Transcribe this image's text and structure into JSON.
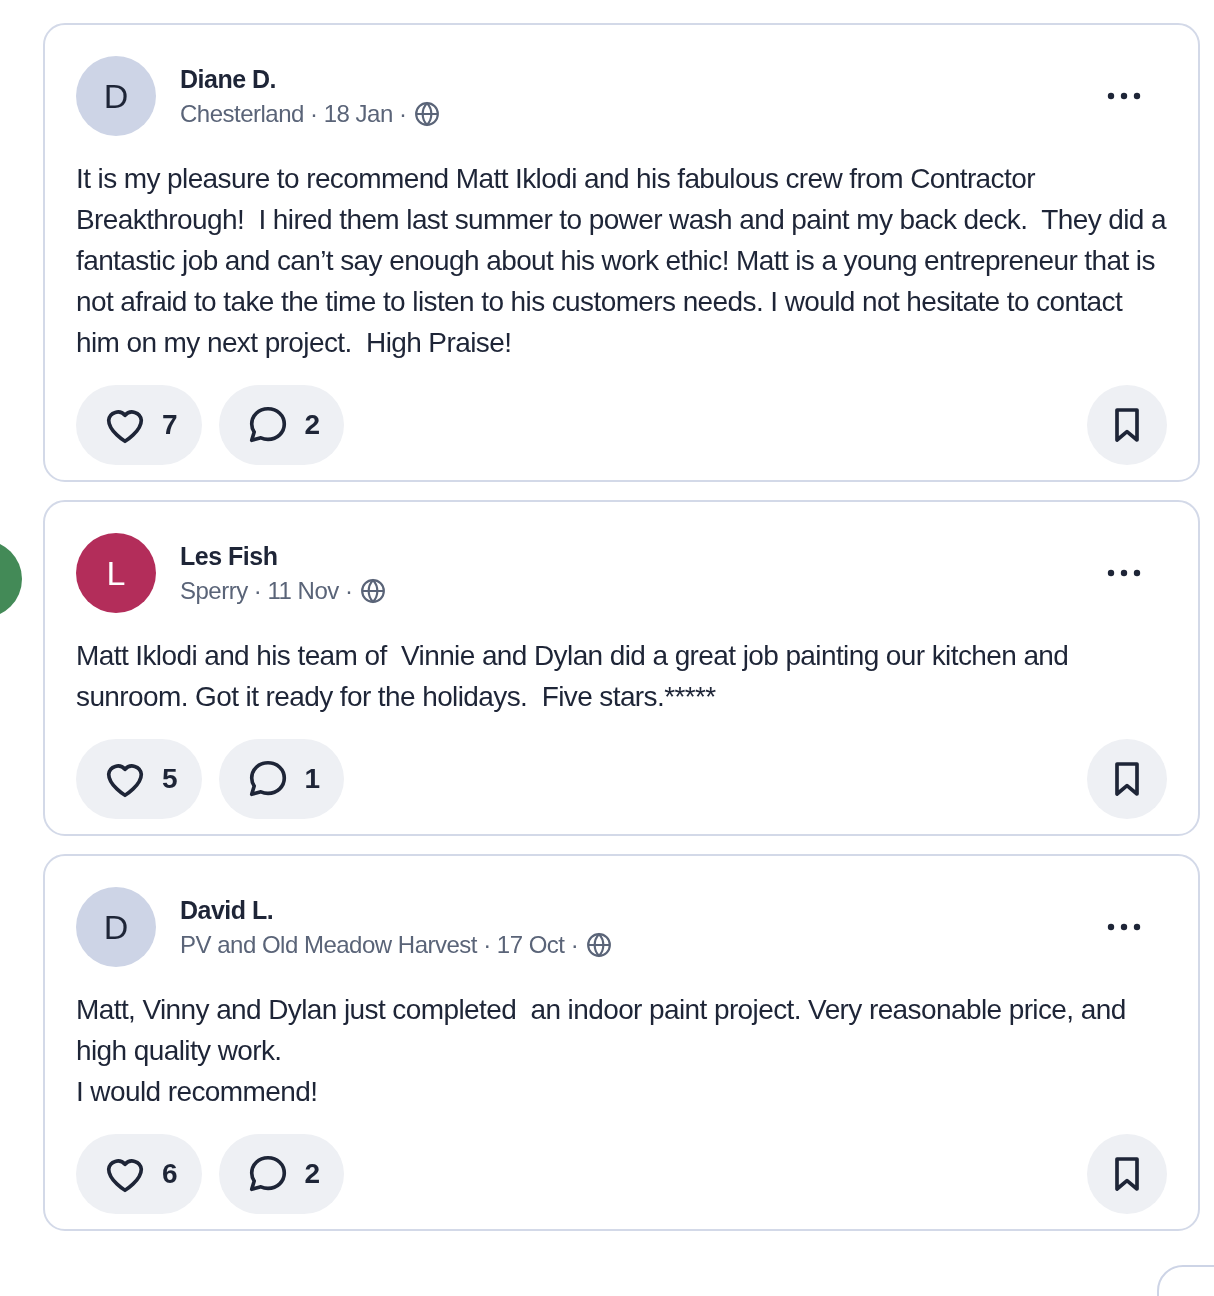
{
  "posts": [
    {
      "author": "Diane D.",
      "initial": "D",
      "color": "#cdd4e6",
      "meta": "Chesterland · 18 Jan ·",
      "body": "It is my pleasure to recommend Matt Iklodi and his fabulous crew from Contractor Breakthrough!  I hired them last summer to power wash and paint my back deck.  They did a fantastic job and can’t say enough about his work ethic! Matt is a young entrepreneur that is not afraid to take the time to listen to his customers needs. I would not hesitate to contact him on my next project.  High Praise!",
      "likes": "7",
      "comments": "2"
    },
    {
      "author": "Les Fish",
      "initial": "L",
      "color": "#b32d5a",
      "meta": "Sperry · 11 Nov ·",
      "body": "Matt Iklodi and his team of  Vinnie and Dylan did a great job painting our kitchen and sunroom. Got it ready for the holidays.  Five stars.*****",
      "likes": "5",
      "comments": "1"
    },
    {
      "author": "David L.",
      "initial": "D",
      "color": "#cdd4e6",
      "meta": "PV and Old Meadow Harvest · 17 Oct ·",
      "body": "Matt, Vinny and Dylan just completed  an indoor paint project. Very reasonable price, and high quality work.\nI would recommend!",
      "likes": "6",
      "comments": "2"
    }
  ]
}
